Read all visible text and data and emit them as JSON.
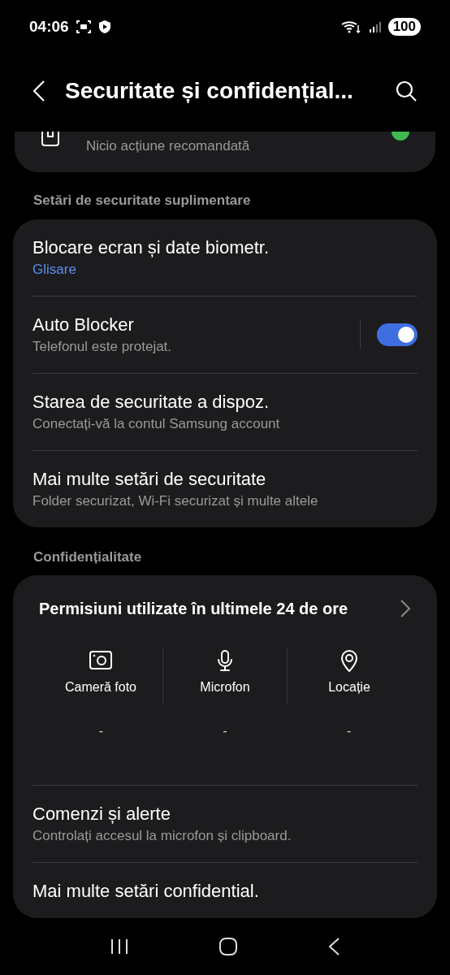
{
  "status_bar": {
    "time": "04:06",
    "battery": "100"
  },
  "header": {
    "title": "Securitate și confidențial..."
  },
  "top_card": {
    "subtitle": "Nicio acțiune recomandată"
  },
  "sections": [
    {
      "title": "Setări de securitate suplimentare",
      "items": [
        {
          "kind": "link",
          "title": "Blocare ecran și date biometr.",
          "subtitle": "Glisare"
        },
        {
          "kind": "switch",
          "title": "Auto Blocker",
          "subtitle": "Telefonul este protejat.",
          "on": true
        },
        {
          "kind": "plain",
          "title": "Starea de securitate a dispoz.",
          "subtitle": "Conectați-vă la contul Samsung account"
        },
        {
          "kind": "plain",
          "title": "Mai multe setări de securitate",
          "subtitle": "Folder securizat, Wi-Fi securizat și multe altele"
        }
      ]
    },
    {
      "title": "Confidențialitate",
      "permissions": {
        "title": "Permisiuni utilizate în ultimele 24 de ore",
        "items": [
          {
            "kind": "camera",
            "label": "Cameră foto",
            "value": "-"
          },
          {
            "kind": "mic",
            "label": "Microfon",
            "value": "-"
          },
          {
            "kind": "location",
            "label": "Locație",
            "value": "-"
          }
        ]
      },
      "items": [
        {
          "kind": "plain",
          "title": "Comenzi și alerte",
          "subtitle": "Controlați accesul la microfon și clipboard."
        },
        {
          "kind": "plain",
          "title": "Mai multe setări confidential."
        }
      ]
    }
  ]
}
